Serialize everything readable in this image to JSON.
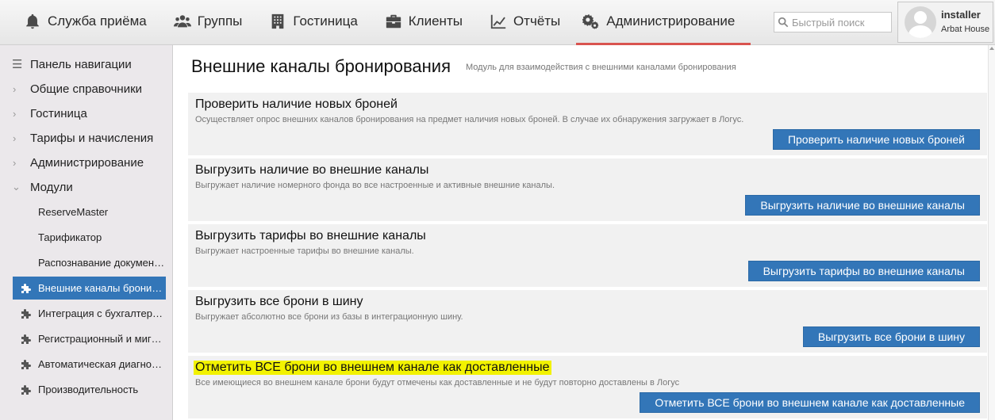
{
  "nav": {
    "items": [
      {
        "label": "Служба приёма",
        "icon": "bell-icon"
      },
      {
        "label": "Группы",
        "icon": "users-icon"
      },
      {
        "label": "Гостиница",
        "icon": "building-icon"
      },
      {
        "label": "Клиенты",
        "icon": "briefcase-icon"
      },
      {
        "label": "Отчёты",
        "icon": "chart-icon"
      },
      {
        "label": "Администрирование",
        "icon": "gears-icon",
        "active": true
      }
    ]
  },
  "search": {
    "placeholder": "Быстрый поиск",
    "value": ""
  },
  "user": {
    "name": "installer",
    "org": "Arbat House"
  },
  "sidebar": {
    "items": [
      {
        "label": "Панель навигации",
        "icon": "menu-icon"
      },
      {
        "label": "Общие справочники",
        "icon": "chevron-right-icon"
      },
      {
        "label": "Гостиница",
        "icon": "chevron-right-icon"
      },
      {
        "label": "Тарифы и начисления",
        "icon": "chevron-right-icon"
      },
      {
        "label": "Администрирование",
        "icon": "chevron-right-icon"
      },
      {
        "label": "Модули",
        "icon": "chevron-down-icon"
      }
    ],
    "sub_items": [
      {
        "label": "ReserveMaster",
        "icon": ""
      },
      {
        "label": "Тарификатор",
        "icon": ""
      },
      {
        "label": "Распознавание документов",
        "icon": ""
      },
      {
        "label": "Внешние каналы бронирования",
        "icon": "puzzle-icon",
        "active": true
      },
      {
        "label": "Интеграция с бухгалтерской системой",
        "icon": "puzzle-icon"
      },
      {
        "label": "Регистрационный и миграционный учёт",
        "icon": "puzzle-icon"
      },
      {
        "label": "Автоматическая диагностика",
        "icon": "puzzle-icon"
      },
      {
        "label": "Производительность",
        "icon": "puzzle-icon"
      }
    ]
  },
  "page": {
    "title": "Внешние каналы бронирования",
    "subtitle": "Модуль для взаимодействия с внешними каналами бронирования"
  },
  "panels": [
    {
      "title": "Проверить наличие новых броней",
      "description": "Осуществляет опрос внешних каналов бронирования на предмет наличия новых броней. В случае их обнаружения загружает в Логус.",
      "button": "Проверить наличие новых броней"
    },
    {
      "title": "Выгрузить наличие во внешние каналы",
      "description": "Выгружает наличие номерного фонда во все настроенные и активные внешние каналы.",
      "button": "Выгрузить наличие во внешние каналы"
    },
    {
      "title": "Выгрузить тарифы во внешние каналы",
      "description": "Выгружает настроенные тарифы во внешние каналы.",
      "button": "Выгрузить тарифы во внешние каналы"
    },
    {
      "title": "Выгрузить все брони в шину",
      "description": "Выгружает абсолютно все брони из базы в интеграционную шину.",
      "button": "Выгрузить все брони в шину"
    },
    {
      "title": "Отметить ВСЕ брони во внешнем канале как доставленные",
      "description": "Все имеющиеся во внешнем канале брони будут отмечены как доставленные и не будут повторно доставлены в Логус",
      "button": "Отметить ВСЕ брони во внешнем канале как доставленные",
      "highlighted": true
    }
  ],
  "colors": {
    "accent": "#3376b8",
    "active_tab_underline": "#d9534f",
    "highlight": "#f2f200"
  }
}
